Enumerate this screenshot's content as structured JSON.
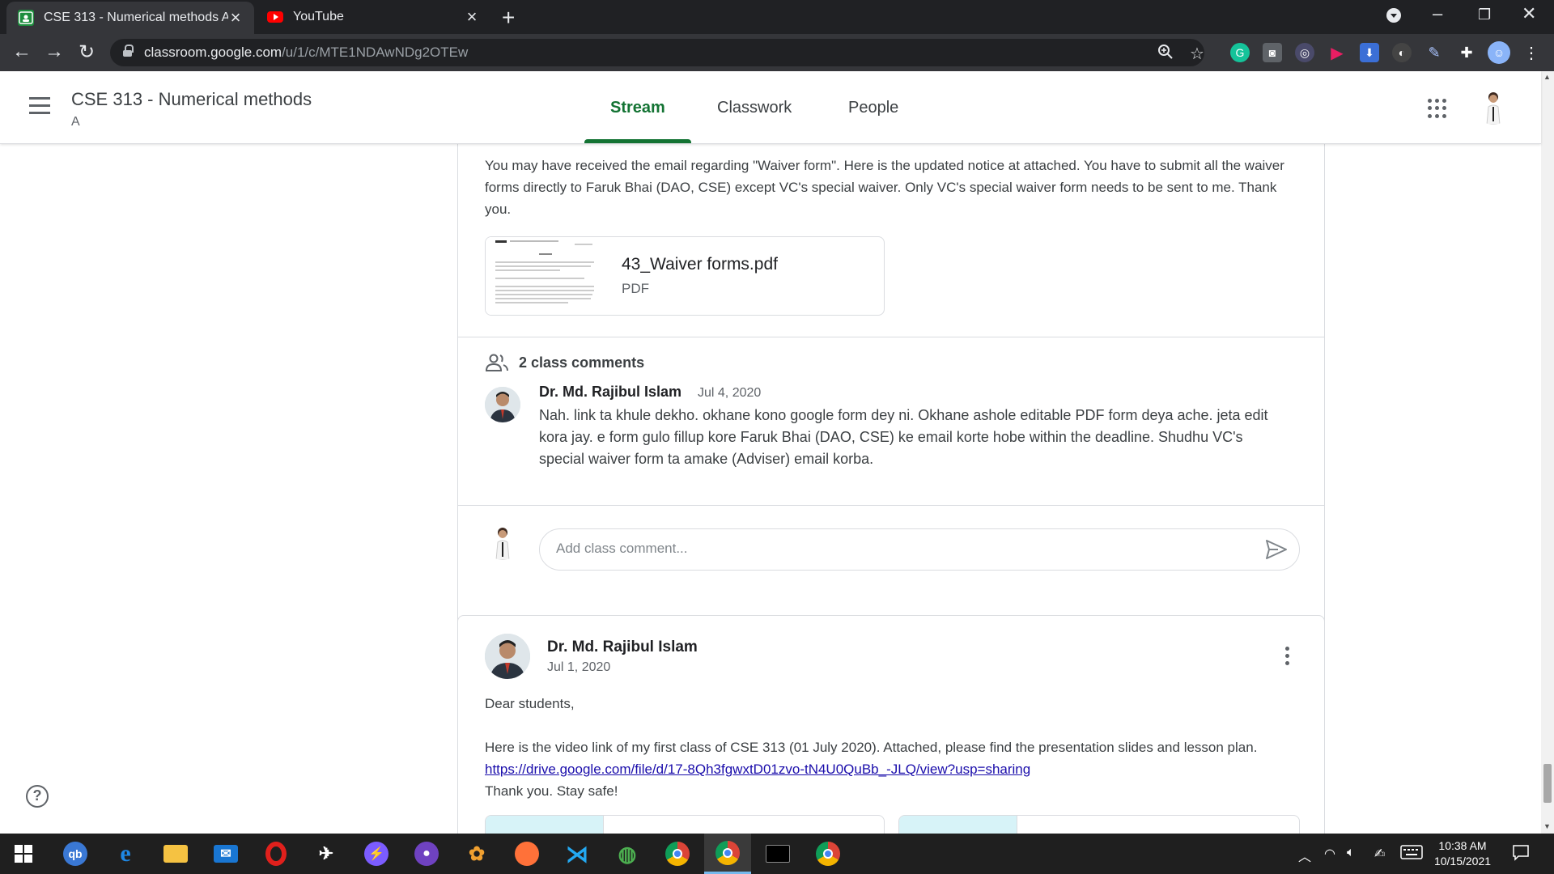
{
  "browser": {
    "tabs": [
      {
        "title": "CSE 313 - Numerical methods A",
        "active": true
      },
      {
        "title": "YouTube",
        "active": false
      }
    ],
    "url_host": "classroom.google.com",
    "url_path": "/u/1/c/MTE1NDAwNDg2OTEw"
  },
  "header": {
    "class_title": "CSE 313 - Numerical methods",
    "class_section": "A",
    "tabs": [
      "Stream",
      "Classwork",
      "People"
    ],
    "active_tab": "Stream"
  },
  "post1": {
    "text": "You may have received the email regarding \"Waiver form\". Here is the updated notice at attached. You have to submit all the waiver forms directly to Faruk Bhai (DAO, CSE) except VC's special waiver. Only VC's special waiver form needs to be sent to me. Thank you.",
    "attachment": {
      "name": "43_Waiver forms.pdf",
      "type": "PDF"
    },
    "comments_count_label": "2 class comments",
    "comment": {
      "author": "Dr. Md. Rajibul Islam",
      "date": "Jul 4, 2020",
      "text": "Nah. link ta khule dekho. okhane kono google form dey ni. Okhane ashole editable PDF form deya ache. jeta edit kora jay. e form gulo fillup kore Faruk Bhai (DAO, CSE) ke email korte hobe within the deadline. Shudhu VC's special waiver form ta amake (Adviser) email korba."
    },
    "comment_placeholder": "Add class comment..."
  },
  "post2": {
    "author": "Dr. Md. Rajibul Islam",
    "date": "Jul 1, 2020",
    "greeting": "Dear students,",
    "body": "Here is the video link of my first class of CSE 313 (01 July 2020). Attached, please find the presentation slides and lesson plan.",
    "link": "https://drive.google.com/file/d/17-8Qh3fgwxtD01zvo-tN4U0QuBb_-JLQ/view?usp=sharing",
    "closing": "Thank you. Stay safe!"
  },
  "taskbar": {
    "time": "10:38 AM",
    "date": "10/15/2021"
  },
  "colors": {
    "accent_green": "#137333",
    "chrome_dark": "#202124",
    "link_blue": "#1a0dab"
  }
}
